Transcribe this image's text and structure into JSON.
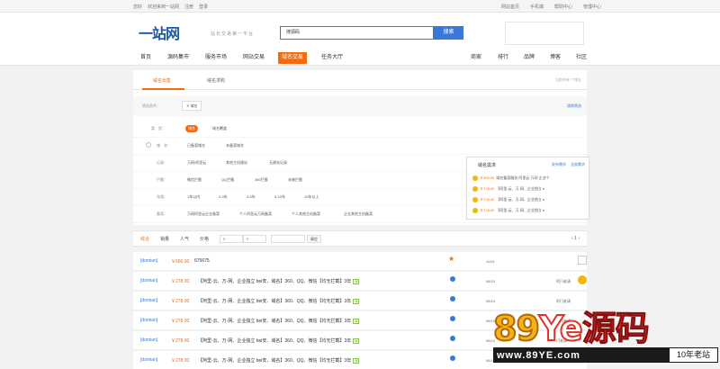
{
  "topbar": {
    "left": [
      "您好",
      "欢迎来到一站网",
      "注册",
      "登录"
    ],
    "right": [
      "网站首页",
      "手机端",
      "帮助中心",
      "管理中心"
    ]
  },
  "header": {
    "logo": "一站网",
    "slogan": "站长交易第一平台",
    "search_value": "搜源码",
    "search_button": "搜索"
  },
  "nav": {
    "left": [
      "首页",
      "源码集市",
      "服务市场",
      "网站交易",
      "域名交易",
      "任务大厅"
    ],
    "right": [
      "商家",
      "排行",
      "品牌",
      "博客",
      "社区"
    ]
  },
  "panel": {
    "tabs": [
      "域名出售",
      "域名求购"
    ],
    "tab_right": "当前共有 个域名",
    "selected_label": "筛选条件：",
    "selected_tag": "✕ 域名",
    "clear": "清除筛选",
    "rows": [
      {
        "label": "类　型：",
        "options": [
          "域名",
          "域名覆盖"
        ]
      },
      {
        "label": "域　名：",
        "options": [
          "已备案域名",
          "未备案域名"
        ]
      },
      {
        "label": "记录：",
        "options": [
          "万网/阿里云",
          "其他主机建站",
          "无建站记录"
        ]
      },
      {
        "label": "拦截：",
        "options": [
          "微信拦截",
          "QQ拦截",
          "360拦截",
          "未被拦截"
        ]
      },
      {
        "label": "年限：",
        "options": [
          "1年以内",
          "2-3年",
          "3-5年",
          "5-10年",
          "10年以上"
        ]
      },
      {
        "label": "备案：",
        "options": [
          "万网阿里云企业备案",
          "个人阿里云万网备案",
          "个人其他主机备案",
          "企业其他主机备案"
        ]
      }
    ]
  },
  "demand": {
    "title": "域名需求",
    "publish": "发布需求",
    "all": "全部需求",
    "items": [
      {
        "price": "￥300.00",
        "text": "域名备案服务 阿里云 万网 企业个"
      },
      {
        "price": "￥278.00",
        "text": "【阿里-云、万-网、企业独立 b"
      },
      {
        "price": "￥278.00",
        "text": "【阿里-云、万-网、企业独立 b"
      },
      {
        "price": "￥278.00",
        "text": "【阿里-云、万-网、企业独立 b"
      }
    ]
  },
  "sortbar": {
    "items": [
      "综合",
      "销量",
      "人气",
      "价格"
    ],
    "min_placeholder": "￥",
    "max_placeholder": "￥",
    "confirm": "确定",
    "pager": "‹ 1 ›"
  },
  "listings": [
    {
      "tag": "[domian]",
      "price": "￥666.00",
      "name": "675675",
      "date": "11/01",
      "seller": ""
    },
    {
      "tag": "[domian]",
      "price": "￥278.00",
      "name": "【阿里-云、万-网、企业独立 bei安、域名】360、QQ、微信【均无拦截】3年",
      "date": "06/10",
      "seller": "阿闩老请"
    },
    {
      "tag": "[domian]",
      "price": "￥278.00",
      "name": "【阿里-云、万-网、企业独立 bei安、域名】360、QQ、微信【均无拦截】3年",
      "date": "06/10",
      "seller": "阿闩老请"
    },
    {
      "tag": "[domian]",
      "price": "￥278.00",
      "name": "【阿里-云、万-网、企业独立 bei安、域名】360、QQ、微信【均无拦截】3年",
      "date": "06/10",
      "seller": "阿闩老请"
    },
    {
      "tag": "[domian]",
      "price": "￥278.00",
      "name": "【阿里-云、万-网、企业独立 bei安、域名】360、QQ、微信【均无拦截】3年",
      "date": "06/10",
      "seller": "闩老请"
    },
    {
      "tag": "[domian]",
      "price": "￥278.00",
      "name": "【阿里-云、万-网、企业独立 bei安、域名】360、QQ、微信【均无拦截】3年",
      "date": "06/10",
      "seller": "老请"
    }
  ],
  "listing_verified": "保",
  "watermark": {
    "big_a": "89",
    "big_b": "Ye",
    "big_c": "源码",
    "url": "www.89YE.com",
    "badge": "10年老站"
  },
  "colors": {
    "accent": "#f26b10",
    "brand": "#3a78d8"
  }
}
